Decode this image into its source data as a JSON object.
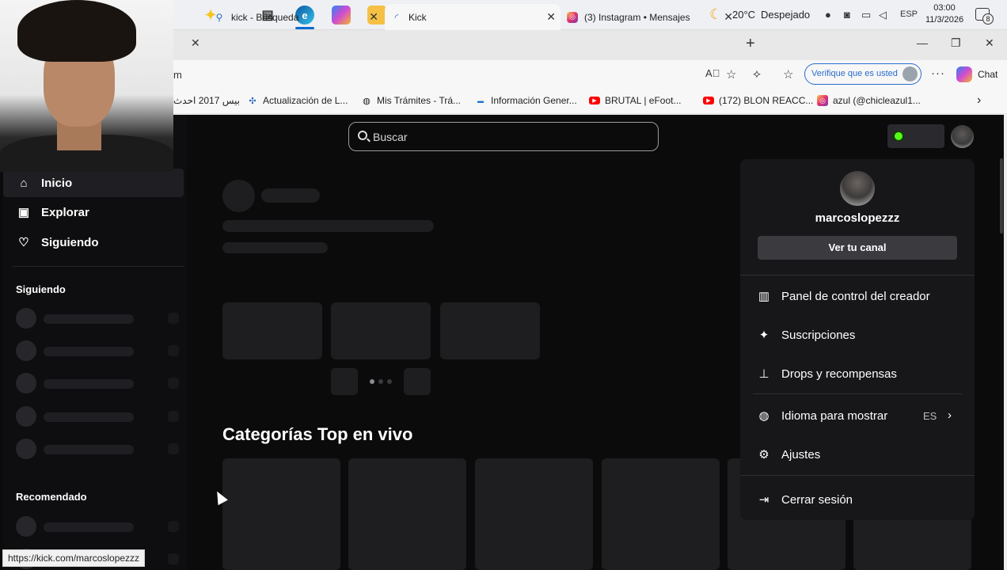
{
  "taskbar": {
    "icons": [
      "copilot-sparkle-icon",
      "task-view-icon",
      "edge-icon",
      "copilot-icon",
      "file-explorer-icon",
      "store-icon",
      "outlook-icon",
      "game-app-icon",
      "obs-icon"
    ],
    "weather": {
      "temp": "20°C",
      "desc": "Despejado"
    },
    "lang": "ESP",
    "time": "03:00",
    "date": "11/3/2026",
    "notifications": "8"
  },
  "browser": {
    "tabs": [
      {
        "title": "kick - Búsqueda",
        "icon": "search-icon"
      },
      {
        "title": "Kick",
        "icon": "loading-icon",
        "active": true
      },
      {
        "title": "(3) Instagram • Mensajes",
        "icon": "instagram-icon"
      }
    ],
    "address_fragment": "m",
    "verify_label": "Verifique que es usted",
    "chat_label": "Chat",
    "bookmarks": [
      {
        "label": "بيس 2017 احدث",
        "icon": ""
      },
      {
        "label": "Actualización de L...",
        "icon": "pinwheel-icon"
      },
      {
        "label": "Mis Trámites - Trá...",
        "icon": "globe-icon"
      },
      {
        "label": "Información Gener...",
        "icon": "site-icon"
      },
      {
        "label": "BRUTAL | eFoot...",
        "icon": "youtube-icon"
      },
      {
        "label": "(172) BLON REACC...",
        "icon": "youtube-icon"
      },
      {
        "label": "azul (@chicleazul1...",
        "icon": "instagram-icon"
      }
    ]
  },
  "kick": {
    "nav": [
      {
        "label": "Inicio",
        "icon": "home-icon",
        "active": true
      },
      {
        "label": "Explorar",
        "icon": "explore-icon"
      },
      {
        "label": "Siguiendo",
        "icon": "heart-icon"
      }
    ],
    "following_heading": "Siguiendo",
    "recommended_heading": "Recomendado",
    "search_placeholder": "Buscar",
    "section_title": "Categorías Top en vivo",
    "user_menu": {
      "username": "marcoslopezzz",
      "channel_button": "Ver tu canal",
      "items": [
        {
          "label": "Panel de control del creador",
          "icon": "chart-icon"
        },
        {
          "label": "Suscripciones",
          "icon": "sparkle-icon"
        },
        {
          "label": "Drops y recompensas",
          "icon": "gift-icon"
        },
        {
          "label": "Idioma para mostrar",
          "icon": "globe-icon",
          "value": "ES"
        },
        {
          "label": "Ajustes",
          "icon": "gear-icon"
        },
        {
          "label": "Cerrar sesión",
          "icon": "logout-icon"
        }
      ]
    },
    "accent": "#53fc18"
  },
  "status_url": "https://kick.com/marcoslopezzz"
}
